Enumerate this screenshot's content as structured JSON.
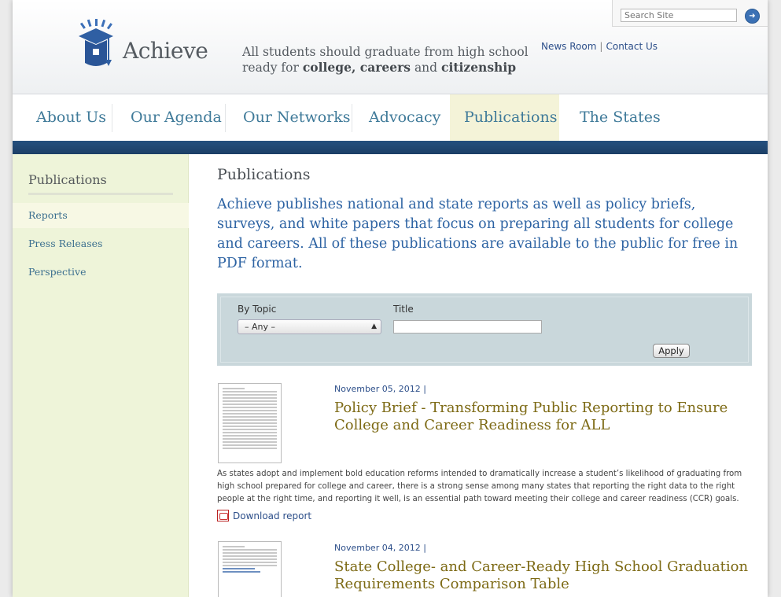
{
  "header": {
    "logo_text": "Achieve",
    "tagline_pre": "All students should graduate from high school",
    "tagline_ready": "ready for ",
    "tagline_b1": "college, careers",
    "tagline_and": " and ",
    "tagline_b2": "citizenship",
    "links": [
      "News Room",
      "Contact Us"
    ],
    "search_placeholder": "Search Site"
  },
  "nav": [
    "About Us",
    "Our Agenda",
    "Our Networks",
    "Advocacy",
    "Publications",
    "The States"
  ],
  "sidebar": {
    "title": "Publications",
    "items": [
      "Reports",
      "Press Releases",
      "Perspective"
    ]
  },
  "main": {
    "title": "Publications",
    "intro": "Achieve publishes national and state reports as well as policy briefs, surveys, and white papers that focus on preparing all students for college and careers. All of these publications are available to the public for free in PDF format."
  },
  "filter": {
    "topic_label": "By Topic",
    "topic_value": "– Any –",
    "title_label": "Title",
    "title_value": "",
    "apply_label": "Apply"
  },
  "entries": [
    {
      "date": "November 05, 2012  |",
      "title": "Policy Brief - Transforming Public Reporting to Ensure College and Career Readiness for ALL",
      "description": "As states adopt and implement bold education reforms intended to dramatically increase a student’s likelihood of graduating from high school prepared for college and career, there is a strong sense among many states that reporting the right data to the right people at the right time, and reporting it well, is an essential path toward meeting their college and career readiness (CCR) goals.",
      "download": "Download report"
    },
    {
      "date": "November 04, 2012  |",
      "title": "State College- and Career-Ready High School Graduation Requirements Comparison Table"
    }
  ],
  "colors": {
    "nav_text": "#3f7a99",
    "active_bg": "#f4f3d8",
    "bar_blue": "#1c3f66",
    "sidebar_bg": "#eef4d9",
    "intro_blue": "#2d63a3",
    "title_gold": "#7d6a15"
  },
  "icons": [
    "graduation-cap-logo-icon",
    "search-arrow-icon",
    "select-arrows-icon",
    "pdf-icon"
  ]
}
